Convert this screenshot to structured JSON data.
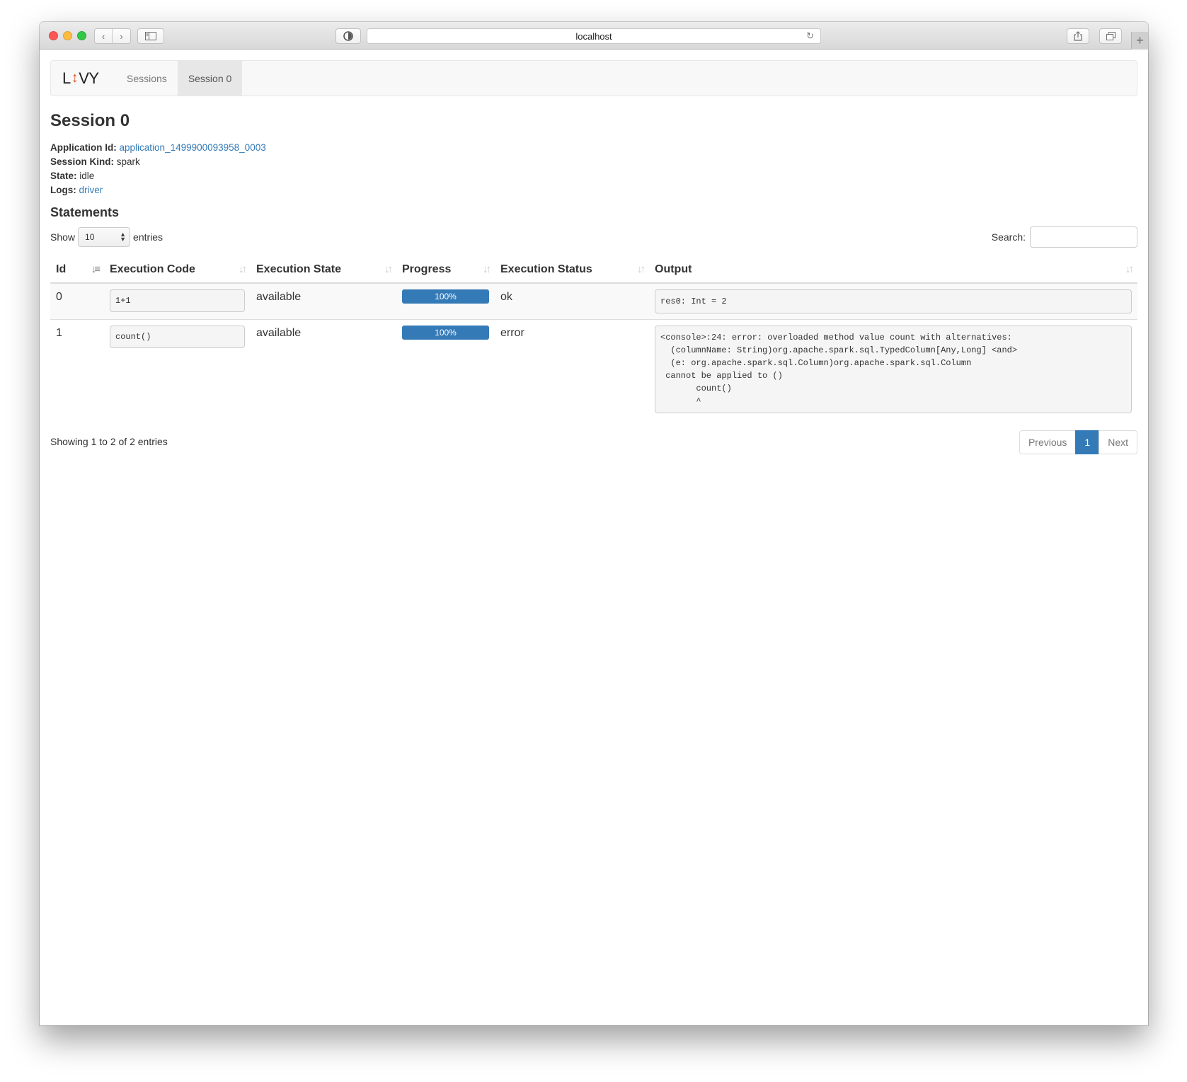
{
  "browser": {
    "url": "localhost"
  },
  "navbar": {
    "brand_left": "L",
    "brand_arrow": "↕",
    "brand_right": "VY",
    "links": [
      {
        "label": "Sessions"
      },
      {
        "label": "Session 0"
      }
    ]
  },
  "session": {
    "title": "Session 0",
    "application_id_label": "Application Id:",
    "application_id": "application_1499900093958_0003",
    "kind_label": "Session Kind:",
    "kind": "spark",
    "state_label": "State:",
    "state": "idle",
    "logs_label": "Logs:",
    "logs_link": "driver"
  },
  "statements": {
    "heading": "Statements",
    "show_label": "Show",
    "page_length": "10",
    "entries_label": "entries",
    "search_label": "Search:",
    "search_value": "",
    "columns": [
      "Id",
      "Execution Code",
      "Execution State",
      "Progress",
      "Execution Status",
      "Output"
    ],
    "rows": [
      {
        "id": "0",
        "code": "1+1",
        "state": "available",
        "progress": "100%",
        "status": "ok",
        "output": "res0: Int = 2"
      },
      {
        "id": "1",
        "code": "count()",
        "state": "available",
        "progress": "100%",
        "status": "error",
        "output": "<console>:24: error: overloaded method value count with alternatives:\n  (columnName: String)org.apache.spark.sql.TypedColumn[Any,Long] <and>\n  (e: org.apache.spark.sql.Column)org.apache.spark.sql.Column\n cannot be applied to ()\n       count()\n       ^"
      }
    ],
    "info": "Showing 1 to 2 of 2 entries",
    "pagination": {
      "previous": "Previous",
      "current": "1",
      "next": "Next"
    }
  },
  "colors": {
    "accent": "#337ab7",
    "brand_arrow": "#e2572a"
  }
}
